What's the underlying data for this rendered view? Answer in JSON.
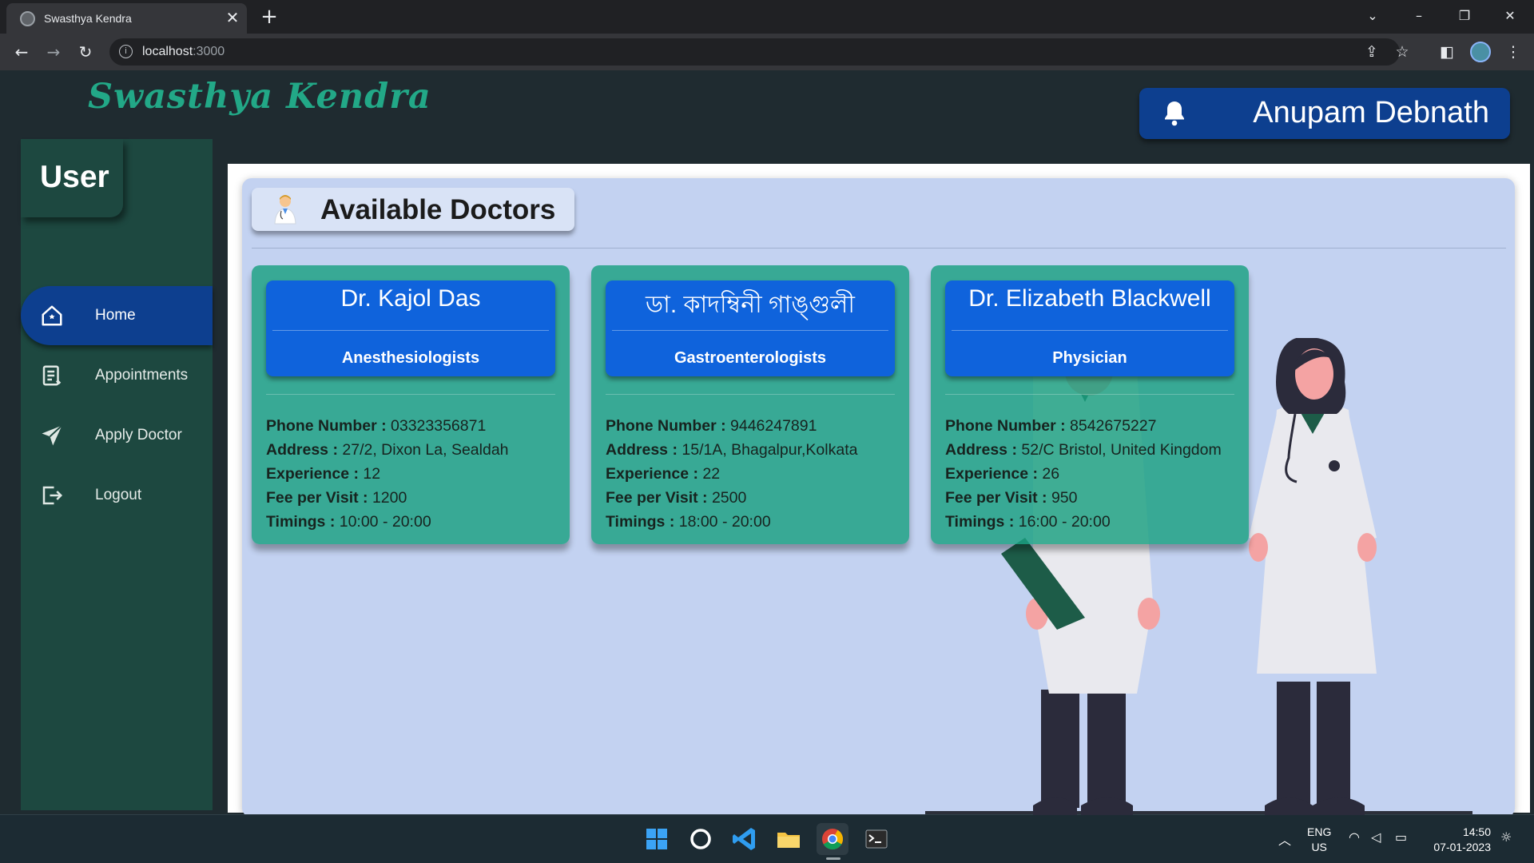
{
  "browser": {
    "tab_title": "Swasthya Kendra",
    "tab_close": "✕",
    "new_tab": "+",
    "url_host": "localhost",
    "url_port": ":3000",
    "window_controls": {
      "dropdown": "⌄",
      "minimize": "–",
      "restore": "❐",
      "close": "✕"
    }
  },
  "header": {
    "brand": "Swasthya Kendra",
    "user_name": "Anupam Debnath"
  },
  "sidebar": {
    "title": "User",
    "items": [
      {
        "label": "Home",
        "icon": "home-icon",
        "active": true
      },
      {
        "label": "Appointments",
        "icon": "list-icon",
        "active": false
      },
      {
        "label": "Apply Doctor",
        "icon": "send-icon",
        "active": false
      },
      {
        "label": "Logout",
        "icon": "logout-icon",
        "active": false
      }
    ]
  },
  "main": {
    "title": "Available Doctors",
    "labels": {
      "phone": "Phone Number :",
      "address": "Address :",
      "experience": "Experience :",
      "fee": "Fee per Visit :",
      "timings": "Timings :"
    },
    "doctors": [
      {
        "name": "Dr. Kajol Das",
        "specialization": "Anesthesiologists",
        "phone": "03323356871",
        "address": "27/2, Dixon La, Sealdah",
        "experience": "12",
        "fee": "1200",
        "timings": "10:00 - 20:00"
      },
      {
        "name": "ডা. কাদম্বিনী গাঙ্গুলী",
        "specialization": "Gastroenterologists",
        "phone": "9446247891",
        "address": "15/1A, Bhagalpur,Kolkata",
        "experience": "22",
        "fee": "2500",
        "timings": "18:00 - 20:00"
      },
      {
        "name": "Dr. Elizabeth Blackwell",
        "specialization": "Physician",
        "phone": "8542675227",
        "address": "52/C Bristol, United Kingdom",
        "experience": "26",
        "fee": "950",
        "timings": "16:00 - 20:00"
      }
    ]
  },
  "taskbar": {
    "lang_line1": "ENG",
    "lang_line2": "US",
    "time": "14:50",
    "date": "07-01-2023",
    "apps": [
      "windows-start-icon",
      "cortana-icon",
      "vscode-icon",
      "file-explorer-icon",
      "chrome-icon",
      "terminal-icon"
    ]
  },
  "colors": {
    "brand": "#22a887",
    "accent_blue": "#0d3f8f",
    "card_head": "#0f63dc",
    "card_bg": "#1aa080",
    "sidebar_bg": "#1d4840",
    "content_bg": "#c3d2f1"
  }
}
